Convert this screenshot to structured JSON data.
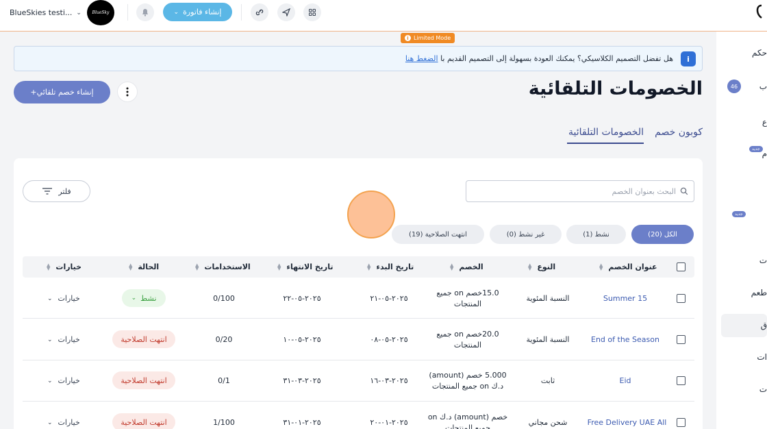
{
  "topbar": {
    "store_name": "BlueSkies testi...",
    "avatar_text": "BlueSky",
    "invoice_label": "إنشاء فاتورة"
  },
  "sidebar": {
    "items": [
      "حكم",
      "ب",
      "ع",
      "م",
      "ت",
      "طعم",
      "ق",
      "ات",
      "ت"
    ],
    "badge_count": "46",
    "new_label": "جديد"
  },
  "limited_mode": "Limited Mode",
  "banner": {
    "text": "هل تفضل التصميم الكلاسيكي؟ يمكنك العودة بسهولة إلى التصميم القديم با",
    "link": "الضغط هنا"
  },
  "header": {
    "title": "الخصومات التلقائية",
    "create_label": "+إنشاء خصم تلقائي"
  },
  "tabs": {
    "auto": "الخصومات التلقائية",
    "coupon": "كوبون خصم"
  },
  "toolbar": {
    "filter_label": "فلتر",
    "search_placeholder": "البحث بعنوان الخصم"
  },
  "status_pills": {
    "all": "الكل (20)",
    "active": "نشط (1)",
    "inactive": "غير نشط (0)",
    "expired": "انتهت الصلاحية (19)"
  },
  "table": {
    "headers": {
      "title": "عنوان الخصم",
      "type": "النوع",
      "discount": "الخصم",
      "start": "تاريخ البدء",
      "end": "تاريخ الانتهاء",
      "usage": "الاستخدامات",
      "status": "الحالة",
      "options": "خيارات"
    },
    "rows": [
      {
        "title": "Summer 15",
        "type": "النسبة المئوية",
        "discount_l1": "15.0خصم on جميع",
        "discount_l2": "المنتجات",
        "start": "٢٠٢٥-٠٥-٢١",
        "end": "٢٠٢٥-٠٥-٢٢",
        "usage": "0/100",
        "status": "نشط",
        "options": "خيارات"
      },
      {
        "title": "End of the Season",
        "type": "النسبة المئوية",
        "discount_l1": "20.0خصم on جميع",
        "discount_l2": "المنتجات",
        "start": "٢٠٢٥-٠٥-٠٨",
        "end": "٢٠٢٥-٠٥-١٠",
        "usage": "0/20",
        "status": "انتهت الصلاحية",
        "options": "خيارات"
      },
      {
        "title": "Eid",
        "type": "ثابت",
        "discount_l1": "5.000 خصم (amount)",
        "discount_l2": "د.ك on جميع المنتجات",
        "start": "٢٠٢٥-٠٣-١٦",
        "end": "٢٠٢٥-٠٣-٣١",
        "usage": "0/1",
        "status": "انتهت الصلاحية",
        "options": "خيارات"
      },
      {
        "title": "Free Delivery UAE All",
        "type": "شحن مجاني",
        "discount_l1": "خصم (amount) د.ك on",
        "discount_l2": "جميع المنتجات",
        "start": "٢٠٢٥-٠١-٢٠",
        "end": "٢٠٢٥-٠١-٣١",
        "usage": "1/100",
        "status": "انتهت الصلاحية",
        "options": "خيارات"
      }
    ]
  }
}
